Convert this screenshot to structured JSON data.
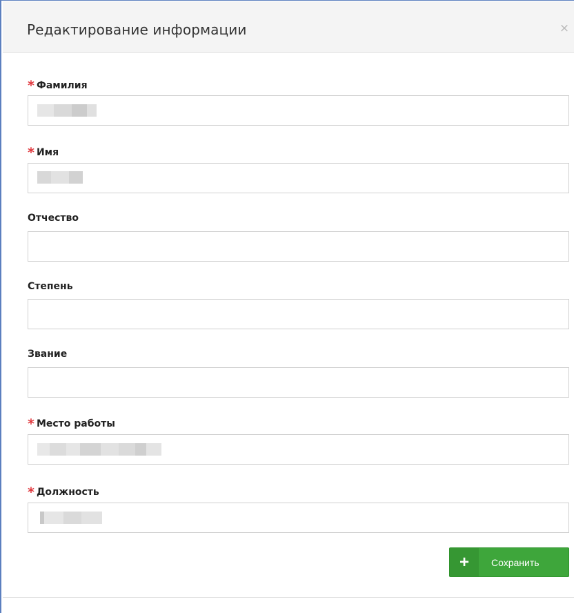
{
  "modal": {
    "title": "Редактирование информации",
    "close_symbol": "×"
  },
  "fields": [
    {
      "label": "Фамилия",
      "required": true,
      "value": ""
    },
    {
      "label": "Имя",
      "required": true,
      "value": ""
    },
    {
      "label": "Отчество",
      "required": false,
      "value": ""
    },
    {
      "label": "Степень",
      "required": false,
      "value": ""
    },
    {
      "label": "Звание",
      "required": false,
      "value": ""
    },
    {
      "label": "Место работы",
      "required": true,
      "value": ""
    },
    {
      "label": "Должность",
      "required": true,
      "value": ""
    }
  ],
  "required_mark": "*",
  "actions": {
    "save_icon": "+",
    "save_label": "Сохранить"
  },
  "colors": {
    "accent_green": "#3ea63b",
    "required_red": "#e0383e",
    "window_border": "#5b7fbf"
  },
  "icons": {
    "close": "close-icon",
    "save": "plus-icon"
  }
}
